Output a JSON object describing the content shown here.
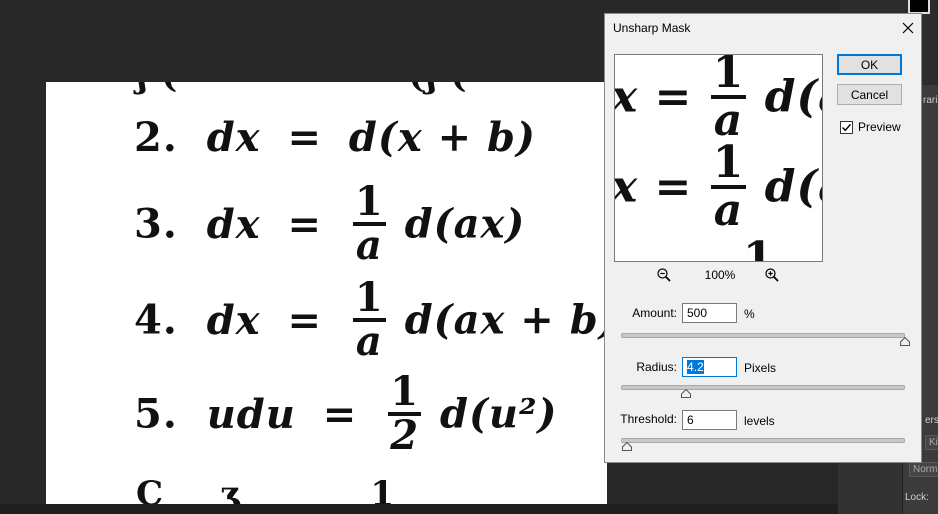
{
  "dialog": {
    "title": "Unsharp Mask",
    "ok_label": "OK",
    "cancel_label": "Cancel",
    "preview_label": "Preview",
    "preview_checked": true,
    "zoom_value": "100%",
    "amount": {
      "label": "Amount:",
      "value": "500",
      "unit": "%",
      "level": 1.0
    },
    "radius": {
      "label": "Radius:",
      "value": "4.2",
      "unit": "Pixels",
      "level": 0.23
    },
    "threshold": {
      "label": "Threshold:",
      "value": "6",
      "unit": "levels",
      "level": 0.02
    }
  },
  "right_panel": {
    "partial_label_1": "rarie",
    "partial_label_2": "ers",
    "partial_label_3": "Kin",
    "blend_mode": "Norma",
    "lock_label": "Lock:"
  },
  "document": {
    "eq2": {
      "num": "2.",
      "lhs": "dx",
      "eq": "=",
      "rhs": "d(x + b)"
    },
    "eq3": {
      "num": "3.",
      "lhs": "dx",
      "eq": "=",
      "frac_num": "1",
      "frac_den": "a",
      "rhs": "d(ax)"
    },
    "eq4": {
      "num": "4.",
      "lhs": "dx",
      "eq": "=",
      "frac_num": "1",
      "frac_den": "a",
      "rhs": "d(ax + b)"
    },
    "eq5": {
      "num": "5.",
      "lhs": "udu",
      "eq": "=",
      "frac_num": "1",
      "frac_den": "2",
      "rhs": "d(u²)"
    }
  },
  "preview": {
    "row1": {
      "lhs": "x =",
      "frac_num": "1",
      "frac_den": "a",
      "rhs": "d(a"
    },
    "row2": {
      "lhs": "x =",
      "frac_num": "1",
      "frac_den": "a",
      "rhs": "d(a"
    },
    "row3_partial": "1"
  }
}
